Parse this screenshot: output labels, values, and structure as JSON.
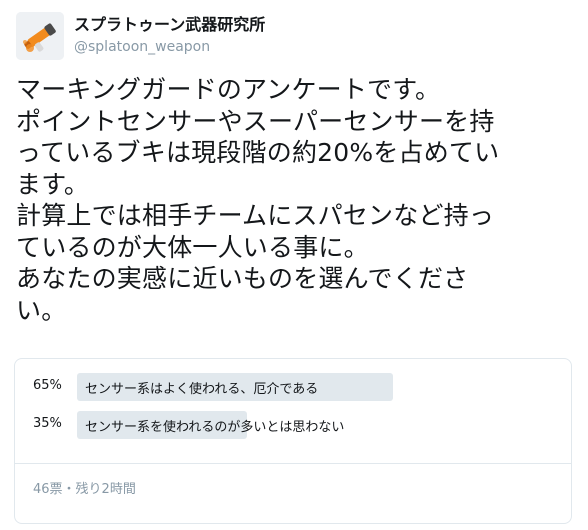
{
  "account": {
    "display_name": "スプラトゥーン武器研究所",
    "handle": "@splatoon_weapon",
    "avatar_icon": "orange-splat-weapon-icon"
  },
  "tweet": {
    "text": "マーキングガードのアンケートです。\nポイントセンサーやスーパーセンサーを持\nっているブキは現段階の約20%を占めてい\nます。\n計算上では相手チームにスパセンなど持っ\nているのが大体一人いる事に。\nあなたの実感に近いものを選んでくださ\nい。"
  },
  "poll": {
    "options": [
      {
        "percent": "65%",
        "value": 0.65,
        "label": "センサー系はよく使われる、厄介である"
      },
      {
        "percent": "35%",
        "value": 0.35,
        "label": "センサー系を使われるのが多いとは思わない"
      }
    ],
    "footer": "46票・残り2時間"
  },
  "colors": {
    "bar": "#e1e8ed",
    "muted_text": "#8899a6",
    "avatar_accent": "#f28b1d"
  }
}
